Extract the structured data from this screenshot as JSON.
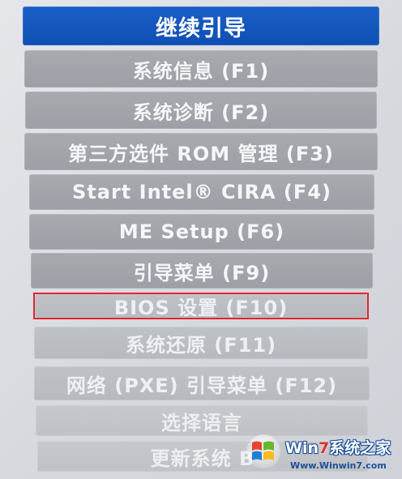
{
  "menu": {
    "items": [
      {
        "label": "继续引导"
      },
      {
        "label": "系统信息 (F1)"
      },
      {
        "label": "系统诊断 (F2)"
      },
      {
        "label": "第三方选件 ROM 管理 (F3)"
      },
      {
        "label": "Start Intel® CIRA (F4)"
      },
      {
        "label": "ME Setup (F6)"
      },
      {
        "label": "引导菜单 (F9)"
      },
      {
        "label": "BIOS 设置 (F10)"
      },
      {
        "label": "系统还原 (F11)"
      },
      {
        "label": "网络 (PXE) 引导菜单 (F12)"
      },
      {
        "label": "选择语言"
      },
      {
        "label": "更新系统 B"
      }
    ]
  },
  "watermark": {
    "brand_prefix": "Win",
    "brand_seven": "7",
    "brand_suffix": "系统之家",
    "url": "Www.Winwin7.com"
  },
  "colors": {
    "primary_button": "#1456c0",
    "button_gray": "#a2a5ab",
    "highlight": "#e0252b"
  }
}
